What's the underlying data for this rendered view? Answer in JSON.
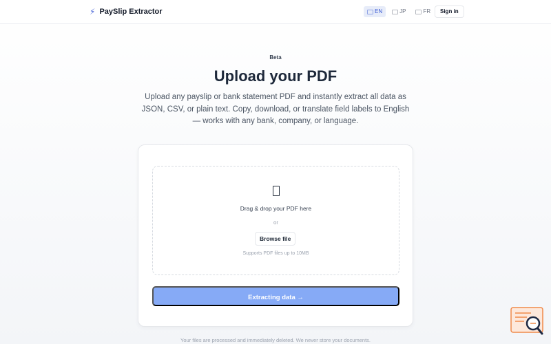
{
  "header": {
    "brand_name": "PaySlip Extractor",
    "brand_icon": "lightning-icon",
    "languages": [
      {
        "code": "EN",
        "active": true
      },
      {
        "code": "JP",
        "active": false
      },
      {
        "code": "FR",
        "active": false
      }
    ],
    "signin_label": "Sign in"
  },
  "hero": {
    "badge": "Beta",
    "title": "Upload your PDF",
    "subtitle": "Upload any payslip or bank statement PDF and instantly extract all data as JSON, CSV, or plain text. Copy, download, or translate field labels to English — works with any bank, company, or language."
  },
  "upload": {
    "drop_text": "Drag & drop your PDF here",
    "or_text": "or",
    "browse_label": "Browse file",
    "support_text": "Supports PDF files up to 10MB",
    "extract_label": "Extracting data →"
  },
  "footer": {
    "privacy_text": "Your files are processed and immediately deleted. We never store your documents."
  },
  "colors": {
    "accent": "#4f6bd8",
    "button": "#86aaf6",
    "widget": "#f08a4b"
  }
}
